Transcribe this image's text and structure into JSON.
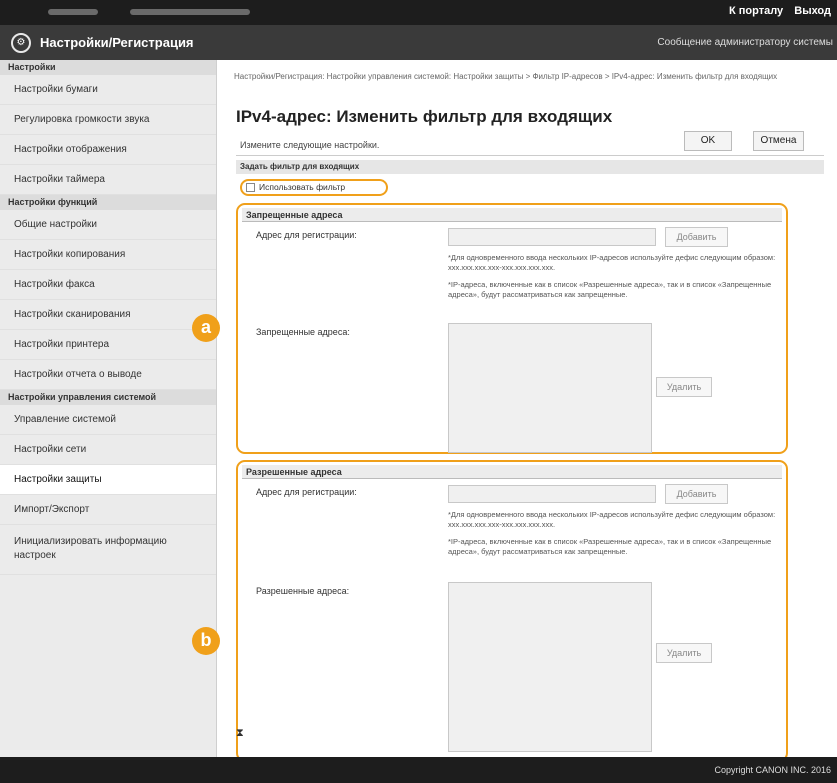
{
  "topbar": {
    "portal_link": "К порталу",
    "logout_link": "Выход"
  },
  "app": {
    "title": "Настройки/Регистрация",
    "admin_message": "Сообщение администратору системы"
  },
  "sidebar": {
    "sections": [
      {
        "label": "Настройки",
        "items": [
          "Настройки бумаги",
          "Регулировка громкости звука",
          "Настройки отображения",
          "Настройки таймера"
        ]
      },
      {
        "label": "Настройки функций",
        "items": [
          "Общие настройки",
          "Настройки копирования",
          "Настройки факса",
          "Настройки сканирования",
          "Настройки принтера",
          "Настройки отчета о выводе"
        ]
      },
      {
        "label": "Настройки управления системой",
        "items": [
          "Управление системой",
          "Настройки сети",
          "Настройки защиты",
          "Импорт/Экспорт",
          "Инициализировать информацию настроек"
        ]
      }
    ],
    "active_item": "Настройки защиты"
  },
  "main": {
    "breadcrumb": "Настройки/Регистрация: Настройки управления системой: Настройки защиты > Фильтр IP-адресов > IPv4-адрес: Изменить фильтр для входящих",
    "title": "IPv4-адрес: Изменить фильтр для входящих",
    "instruction": "Измените следующие настройки.",
    "ok_label": "OK",
    "cancel_label": "Отмена",
    "settings_header": "Задать фильтр для входящих",
    "use_filter_label": "Использовать фильтр",
    "use_filter_checked": false,
    "denied": {
      "header": "Запрещенные адреса",
      "register_label": "Адрес для регистрации:",
      "add_label": "Добавить",
      "note1": "*Для одновременного ввода нескольких IP-адресов используйте дефис следующим образом: xxx.xxx.xxx.xxx-xxx.xxx.xxx.xxx.",
      "note2": "*IP-адреса, включенные как в список «Разрешенные адреса», так и в список «Запрещенные адреса», будут рассматриваться как запрещенные.",
      "list_label": "Запрещенные адреса:",
      "delete_label": "Удалить"
    },
    "allowed": {
      "header": "Разрешенные адреса",
      "register_label": "Адрес для регистрации:",
      "add_label": "Добавить",
      "note1": "*Для одновременного ввода нескольких IP-адресов используйте дефис следующим образом: xxx.xxx.xxx.xxx-xxx.xxx.xxx.xxx.",
      "note2": "*IP-адреса, включенные как в список «Разрешенные адреса», так и в список «Запрещенные адреса», будут рассматриваться как запрещенные.",
      "list_label": "Разрешенные адреса:",
      "delete_label": "Удалить"
    },
    "marker_a": "a",
    "marker_b": "b",
    "to_top": "⧗"
  },
  "footer": {
    "copyright": "Copyright CANON INC. 2016"
  },
  "colors": {
    "highlight": "#f0a01a",
    "header_bg": "#3a3a3a",
    "topbar_bg": "#1d1d1d"
  }
}
